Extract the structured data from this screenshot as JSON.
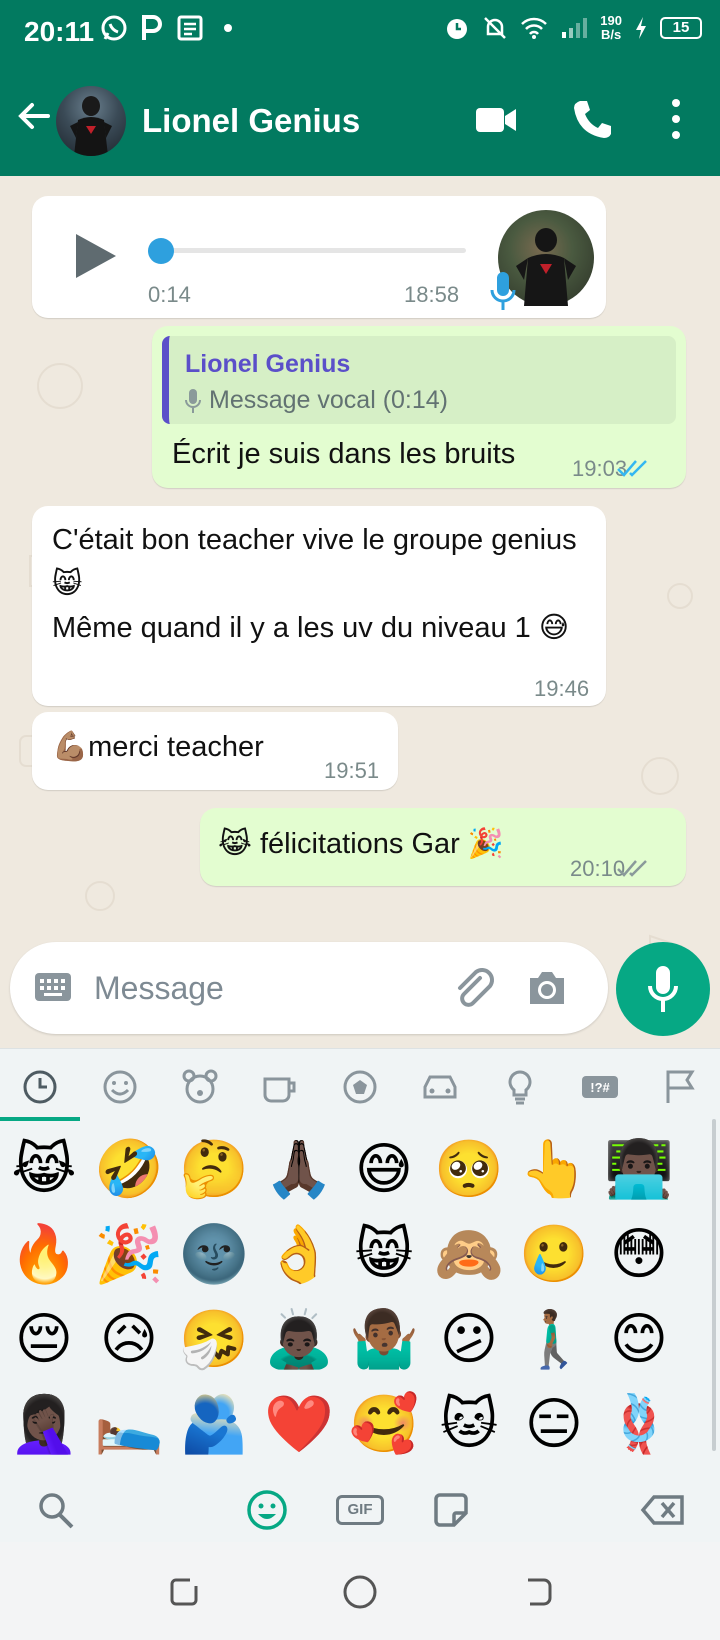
{
  "status_bar": {
    "time": "20:11",
    "net_speed_value": "190",
    "net_speed_unit": "B/s",
    "battery": "15"
  },
  "app_bar": {
    "contact_name": "Lionel Genius",
    "icons": [
      "back-arrow-icon",
      "video-call-icon",
      "phone-icon",
      "more-vert-icon"
    ]
  },
  "messages": [
    {
      "type": "voice",
      "direction": "in",
      "duration": "0:14",
      "time": "18:58"
    },
    {
      "type": "reply",
      "direction": "out",
      "quote_author": "Lionel Genius",
      "quote_text": "Message vocal (0:14)",
      "text": "Écrit je suis dans les bruits",
      "time": "19:03",
      "status": "read"
    },
    {
      "type": "text",
      "direction": "in",
      "text": "C'était bon teacher vive le groupe genius😸\nMême quand il y a les uv du niveau 1 😅",
      "time": "19:46"
    },
    {
      "type": "text",
      "direction": "in",
      "text": "💪🏽merci teacher",
      "time": "19:51"
    },
    {
      "type": "text",
      "direction": "out",
      "text": "😹 félicitations Gar 🎉",
      "time": "20:10",
      "status": "delivered"
    }
  ],
  "composer": {
    "placeholder": "Message"
  },
  "emoji_keyboard": {
    "categories": [
      "recent",
      "smileys",
      "animals",
      "food",
      "activity",
      "travel",
      "objects",
      "symbols",
      "flags"
    ],
    "selected_category": "recent",
    "emojis": [
      "😹",
      "🤣",
      "🤔",
      "🙏🏿",
      "😅",
      "🥺",
      "👆",
      "👨🏿‍💻",
      "🔥",
      "🎉",
      "🌚",
      "👌",
      "😸",
      "🙈",
      "🥲",
      "😳",
      "😔",
      "😥",
      "🤧",
      "🙇🏿‍♂️",
      "🤷🏾‍♂️",
      "😕",
      "🚶🏾‍♂️",
      "😊",
      "🤦🏿‍♀️",
      "🛌",
      "🫂",
      "❤️",
      "🥰",
      "🐱",
      "😑",
      "🪢"
    ],
    "tools": [
      "search-icon",
      "emoji-icon",
      "gif-icon",
      "sticker-icon",
      "backspace-icon"
    ],
    "gif_label": "GIF"
  },
  "colors": {
    "header": "#027a60",
    "accent": "#06a884",
    "outgoing_bubble": "#e3fdd0",
    "read_ticks": "#34b7f1",
    "quote_author": "#5b4fc9"
  }
}
